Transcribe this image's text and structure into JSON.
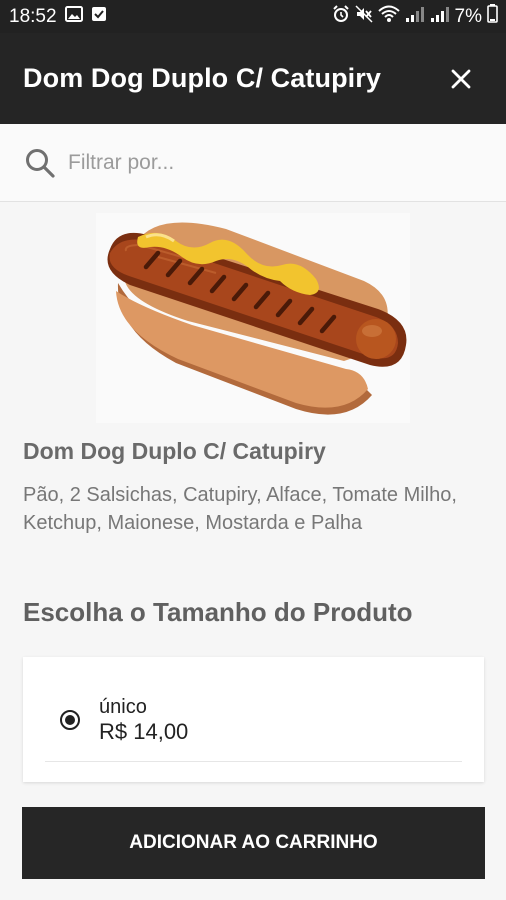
{
  "status_bar": {
    "time": "18:52",
    "battery": "7%",
    "left_icons": [
      "gallery-icon",
      "checkbox-notification-icon"
    ],
    "right_icons": [
      "alarm-icon",
      "mute-icon",
      "wifi-icon",
      "signal-icon",
      "signal-icon",
      "battery-icon"
    ]
  },
  "header": {
    "title": "Dom Dog Duplo C/ Catupiry",
    "close_icon": "close-icon"
  },
  "search": {
    "icon": "search-icon",
    "placeholder": "Filtrar por..."
  },
  "product": {
    "image": "hot-dog-illustration",
    "name": "Dom Dog Duplo C/ Catupiry",
    "description": "Pão, 2 Salsichas, Catupiry, Alface, Tomate Milho, Ketchup, Maionese, Mostarda e Palha"
  },
  "size_section": {
    "title": "Escolha o Tamanho do Produto",
    "options": [
      {
        "name": "único",
        "price": "R$ 14,00",
        "selected": true
      }
    ]
  },
  "add_button": {
    "label": "ADICIONAR AO CARRINHO"
  },
  "colors": {
    "header_bg": "#252525",
    "status_bar_bg": "#222222",
    "button_bg": "#262626",
    "page_bg": "#f6f6f6"
  }
}
